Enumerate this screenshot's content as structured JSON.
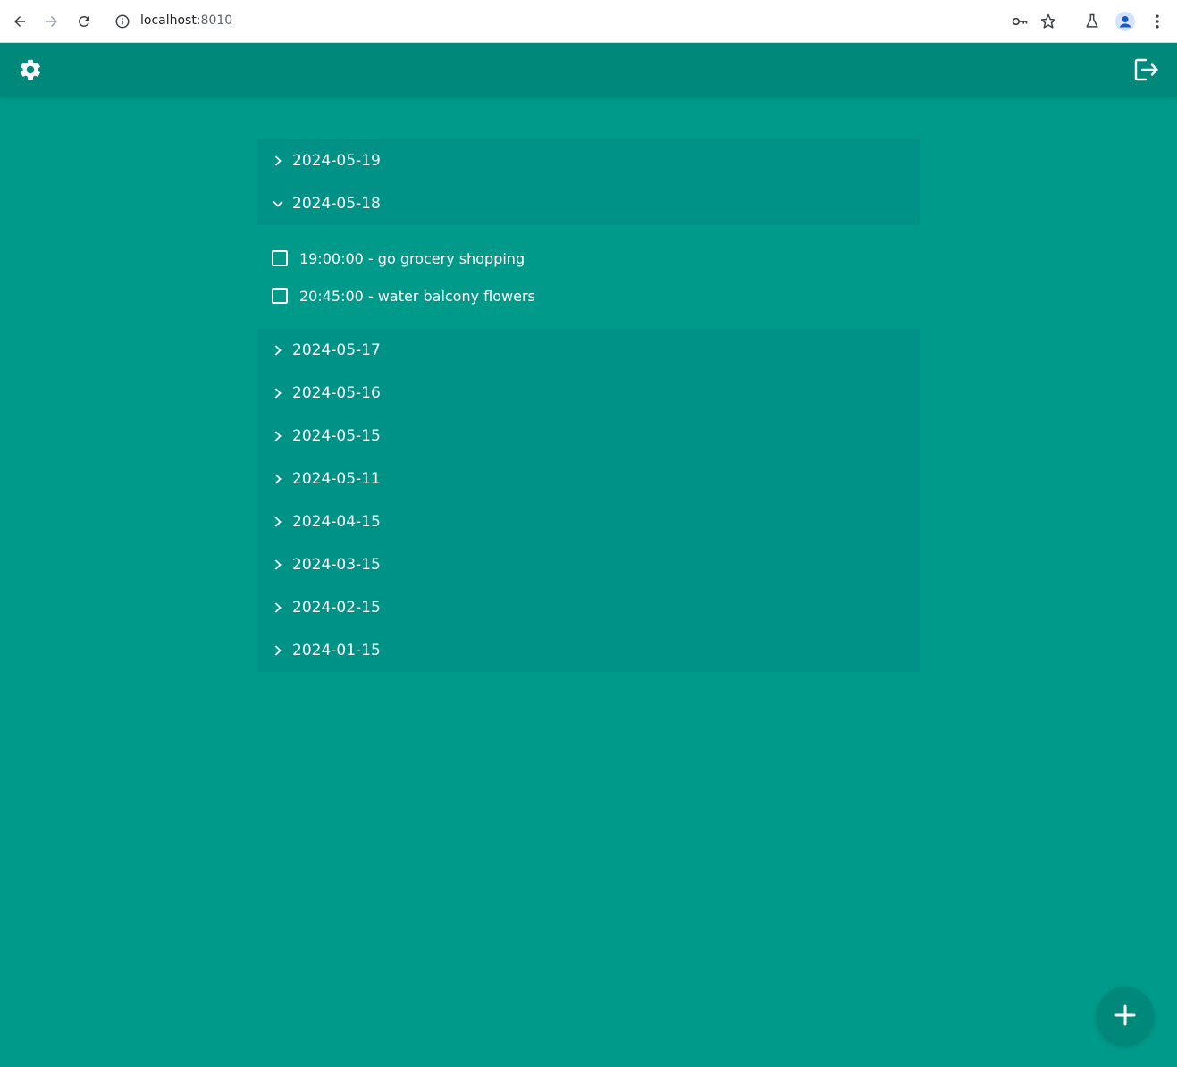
{
  "browser": {
    "url_host": "localhost",
    "url_port": ":8010"
  },
  "app_bar": {
    "settings_icon": "gear-icon",
    "logout_icon": "logout-icon"
  },
  "dates_top": [
    {
      "label": "2024-05-19",
      "expanded": false
    },
    {
      "label": "2024-05-18",
      "expanded": true
    }
  ],
  "tasks": [
    {
      "label": "19:00:00 - go grocery shopping",
      "checked": false
    },
    {
      "label": "20:45:00 - water balcony flowers",
      "checked": false
    }
  ],
  "dates_bottom": [
    {
      "label": "2024-05-17",
      "expanded": false
    },
    {
      "label": "2024-05-16",
      "expanded": false
    },
    {
      "label": "2024-05-15",
      "expanded": false
    },
    {
      "label": "2024-05-11",
      "expanded": false
    },
    {
      "label": "2024-04-15",
      "expanded": false
    },
    {
      "label": "2024-03-15",
      "expanded": false
    },
    {
      "label": "2024-02-15",
      "expanded": false
    },
    {
      "label": "2024-01-15",
      "expanded": false
    }
  ],
  "fab": {
    "icon": "plus-icon"
  },
  "colors": {
    "background": "#009A8A",
    "app_bar": "#00897B",
    "panel": "#009286",
    "text": "#ffffff"
  }
}
